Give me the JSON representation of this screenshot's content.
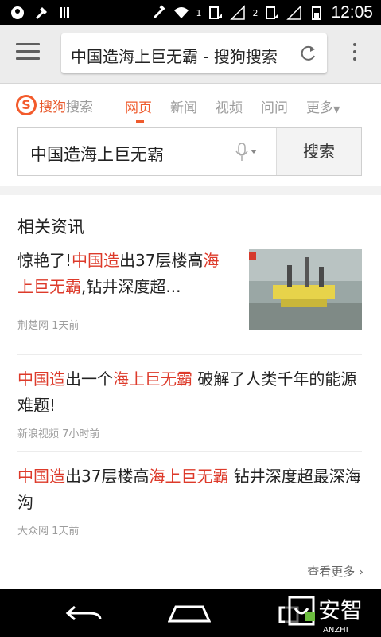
{
  "status_bar": {
    "time": "12:05",
    "icons": [
      "notification-icon",
      "tools-icon",
      "barcode-icon",
      "satellite-icon",
      "wifi-icon",
      "sim1-signal-icon",
      "sim2-signal-icon",
      "signal-icon",
      "battery-icon"
    ],
    "sim1_label": "1",
    "sim2_label": "2"
  },
  "toolbar": {
    "url_text": "中国造海上巨无霸 - 搜狗搜索",
    "icons": [
      "menu-icon",
      "reload-icon",
      "overflow-icon"
    ]
  },
  "sogou": {
    "logo_mark": "S",
    "logo_brand": "搜狗",
    "logo_suffix": "搜索",
    "tabs": [
      {
        "label": "网页",
        "active": true
      },
      {
        "label": "新闻",
        "active": false
      },
      {
        "label": "视频",
        "active": false
      },
      {
        "label": "问问",
        "active": false
      },
      {
        "label": "更多",
        "active": false
      }
    ],
    "search_value": "中国造海上巨无霸",
    "search_button": "搜索",
    "accent_color": "#ef5b2d"
  },
  "news": {
    "section_title": "相关资讯",
    "items": [
      {
        "title_parts": [
          "惊艳了!",
          "中国造",
          "出37层楼高",
          "海上巨无霸",
          ",钻井深度超..."
        ],
        "source": "荆楚网",
        "time": "1天前",
        "has_thumbnail": true
      },
      {
        "title_parts": [
          "中国造",
          "出一个",
          "海上巨无霸",
          " 破解了人类千年的能源难题!"
        ],
        "source": "新浪视频",
        "time": "7小时前"
      },
      {
        "title_parts": [
          "中国造",
          "出37层楼高",
          "海上巨无霸",
          " 钻井深度超最深海沟"
        ],
        "source": "大众网",
        "time": "1天前"
      }
    ],
    "view_more": "查看更多",
    "highlight_color": "#dd3a2a"
  },
  "watermark": {
    "text": "安智",
    "subtext": "ANZHI"
  },
  "navbar": {
    "icons": [
      "back-icon",
      "home-icon",
      "recents-icon"
    ]
  }
}
